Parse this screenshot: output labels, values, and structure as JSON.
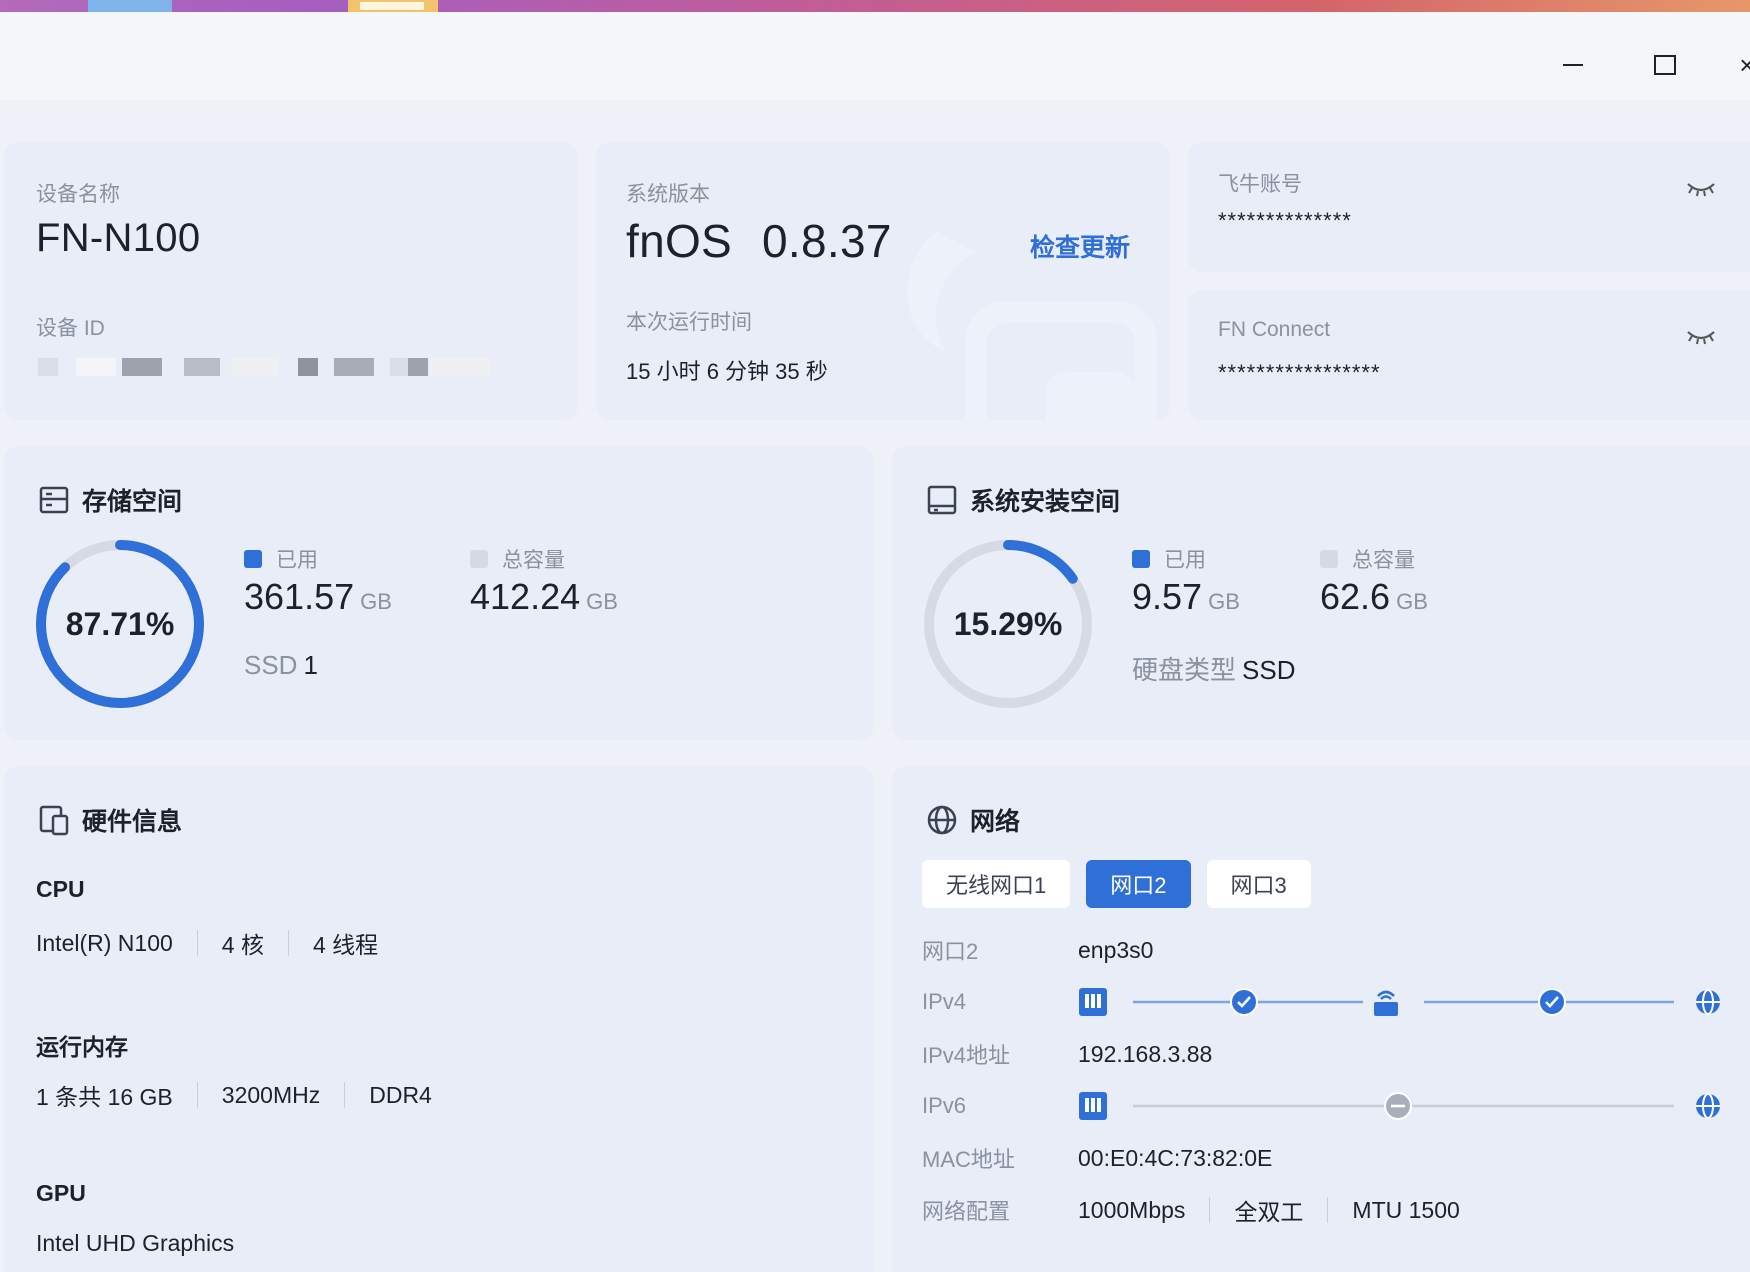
{
  "window": {
    "controls": {
      "minimize": "minimize-icon",
      "maximize": "maximize-icon",
      "close": "close-icon"
    }
  },
  "device": {
    "name_label": "设备名称",
    "name": "FN-N100",
    "id_label": "设备 ID"
  },
  "version": {
    "label": "系统版本",
    "os": "fnOS",
    "number": "0.8.37",
    "check_update": "检查更新",
    "uptime_label": "本次运行时间",
    "uptime": "15 小时 6 分钟 35 秒"
  },
  "account": {
    "label": "飞牛账号",
    "value": "**************"
  },
  "connect": {
    "label": "FN Connect",
    "value": "*****************"
  },
  "storage": {
    "title": "存储空间",
    "percent_label": "87.71%",
    "percent": 87.71,
    "used_label": "已用",
    "used_value": "361.57",
    "total_label": "总容量",
    "total_value": "412.24",
    "unit": "GB",
    "disk_type": "SSD",
    "disk_count": "1"
  },
  "sysdisk": {
    "title": "系统安装空间",
    "percent_label": "15.29%",
    "percent": 15.29,
    "used_label": "已用",
    "used_value": "9.57",
    "total_label": "总容量",
    "total_value": "62.6",
    "unit": "GB",
    "type_label": "硬盘类型",
    "type_value": "SSD"
  },
  "hardware": {
    "title": "硬件信息",
    "cpu_label": "CPU",
    "cpu": [
      "Intel(R) N100",
      "4 核",
      "4 线程"
    ],
    "mem_label": "运行内存",
    "mem": [
      "1 条共 16 GB",
      "3200MHz",
      "DDR4"
    ],
    "gpu_label": "GPU",
    "gpu": "Intel UHD Graphics"
  },
  "network": {
    "title": "网络",
    "tabs": [
      "无线网口1",
      "网口2",
      "网口3"
    ],
    "active_tab": 1,
    "rows": {
      "port_label": "网口2",
      "port_value": "enp3s0",
      "ipv4_label": "IPv4",
      "ipv4_addr_label": "IPv4地址",
      "ipv4_addr": "192.168.3.88",
      "ipv6_label": "IPv6",
      "mac_label": "MAC地址",
      "mac": "00:E0:4C:73:82:0E",
      "config_label": "网络配置",
      "config": [
        "1000Mbps",
        "全双工",
        "MTU 1500"
      ]
    }
  },
  "colors": {
    "accent": "#2f6fd8",
    "card_bg": "#e8edf7",
    "track": "#d5dae3"
  }
}
